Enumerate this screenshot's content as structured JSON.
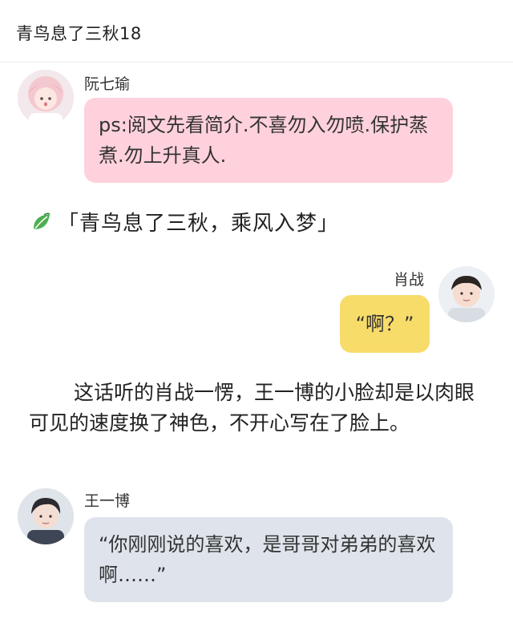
{
  "header": {
    "title": "青鸟息了三秋18"
  },
  "messages": [
    {
      "speaker": "阮七瑜",
      "text": "ps:阅文先看简介.不喜勿入勿喷.保护蒸煮.勿上升真人."
    },
    {
      "speaker": "肖战",
      "text": "“啊？”"
    },
    {
      "speaker": "王一博",
      "text": "“你刚刚说的喜欢，是哥哥对弟弟的喜欢啊……”"
    }
  ],
  "chapter": {
    "icon": "leaf-icon",
    "text": "「青鸟息了三秋，乘风入梦」"
  },
  "narration": {
    "text": "这话听的肖战一愣，王一博的小脸却是以肉眼可见的速度换了神色，不开心写在了脸上。"
  },
  "colors": {
    "pink_bubble": "#ffd1dc",
    "yellow_bubble": "#f8dc6a",
    "grey_bubble": "#dfe4ec",
    "leaf_green": "#4caf50"
  }
}
